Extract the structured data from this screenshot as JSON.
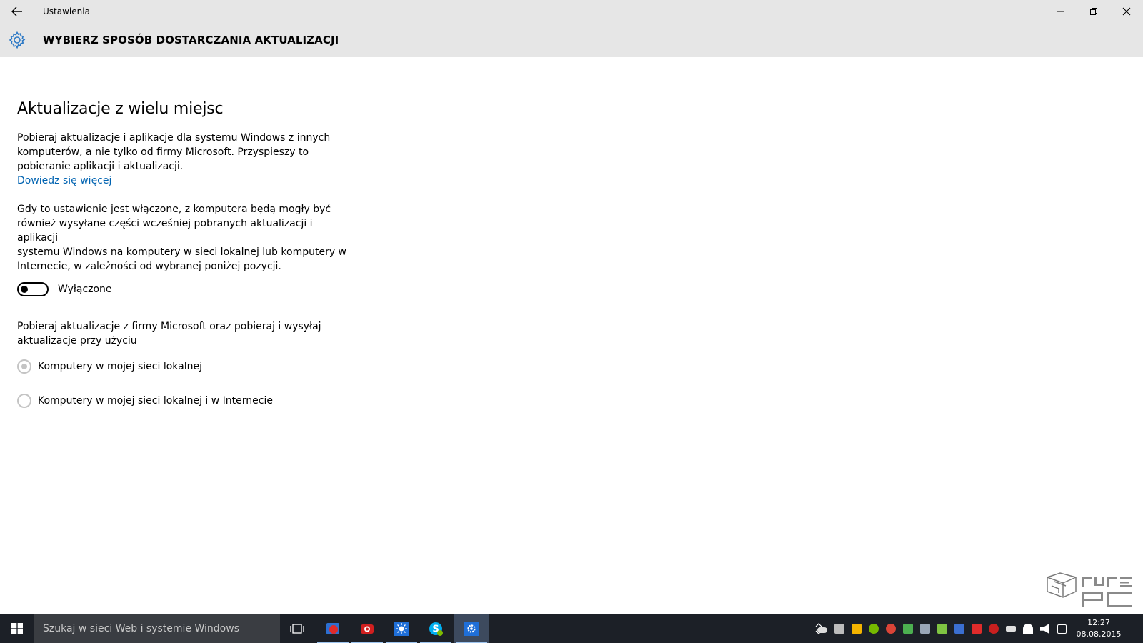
{
  "window": {
    "title": "Ustawienia",
    "controls": [
      "minimize",
      "restore",
      "close"
    ]
  },
  "header": {
    "title": "WYBIERZ SPOSÓB DOSTARCZANIA AKTUALIZACJI",
    "icon": "gear-icon"
  },
  "content": {
    "section_title": "Aktualizacje z wielu miejsc",
    "intro_lines": [
      "Pobieraj aktualizacje i aplikacje dla systemu Windows z innych",
      "komputerów, a nie tylko od firmy Microsoft. Przyspieszy to",
      "pobieranie aplikacji i aktualizacji."
    ],
    "learn_more_link": "Dowiedz się więcej",
    "description_lines": [
      "Gdy to ustawienie jest włączone, z komputera będą mogły być",
      "również wysyłane części wcześniej pobranych aktualizacji i aplikacji",
      "systemu Windows na komputery w sieci lokalnej lub komputery w",
      "Internecie, w zależności od wybranej poniżej pozycji."
    ],
    "toggle": {
      "state": "off",
      "label": "Wyłączone"
    },
    "options_intro_lines": [
      "Pobieraj aktualizacje z firmy Microsoft oraz pobieraj i wysyłaj",
      "aktualizacje przy użyciu"
    ],
    "radio_options": [
      {
        "label": "Komputery w mojej sieci lokalnej",
        "selected": true,
        "disabled": true
      },
      {
        "label": "Komputery w mojej sieci lokalnej i w Internecie",
        "selected": false,
        "disabled": true
      }
    ]
  },
  "taskbar": {
    "search_placeholder": "Szukaj w sieci Web i systemie Windows",
    "pinned": [
      "task-view-icon",
      "media-app-icon",
      "red-app-icon",
      "brightness-app-icon",
      "skype-icon",
      "settings-icon"
    ],
    "clock": {
      "time": "12:27",
      "date": "08.08.2015"
    }
  },
  "colors": {
    "titlebar_bg": "#e6e6e6",
    "link": "#0063b1",
    "taskbar_bg": "#1c2027",
    "search_bg": "#3a3d42",
    "active_app_bg": "#3d4a5e"
  }
}
